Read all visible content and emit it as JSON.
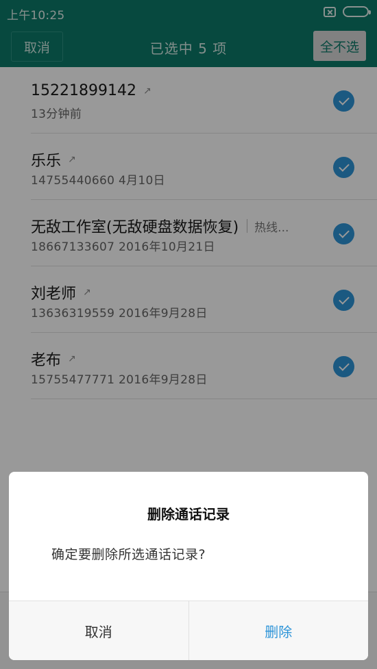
{
  "status": {
    "time": "上午10:25"
  },
  "header": {
    "cancel_label": "取消",
    "title": "已选中 5 项",
    "select_none_label": "全不选"
  },
  "calls": [
    {
      "name": "15221899142",
      "tag": "",
      "sub": "13分钟前",
      "selected": true
    },
    {
      "name": "乐乐",
      "tag": "",
      "sub": "14755440660  4月10日",
      "selected": true
    },
    {
      "name": "无敌工作室(无敌硬盘数据恢复)",
      "tag": "热线...",
      "sub": "18667133607  2016年10月21日",
      "selected": true
    },
    {
      "name": "刘老师",
      "tag": "",
      "sub": "13636319559  2016年9月28日",
      "selected": true
    },
    {
      "name": "老布",
      "tag": "",
      "sub": "15755477771  2016年9月28日",
      "selected": true
    }
  ],
  "dialog": {
    "title": "删除通话记录",
    "message": "确定要删除所选通话记录?",
    "cancel_label": "取消",
    "delete_label": "删除"
  },
  "colors": {
    "accent": "#0c7a6a",
    "check": "#2d94d8"
  }
}
